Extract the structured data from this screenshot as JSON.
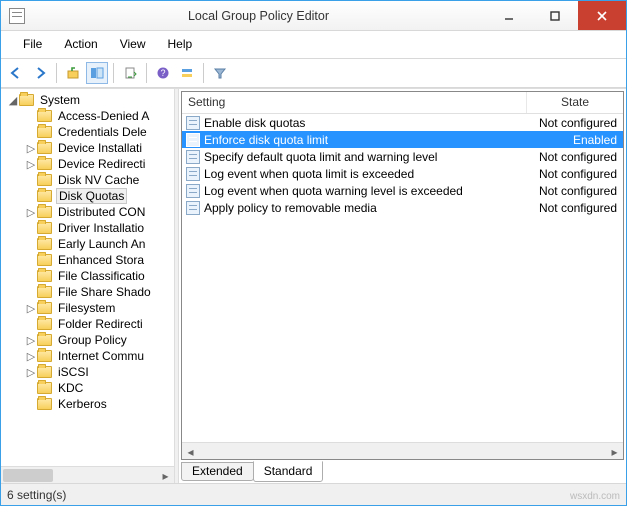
{
  "window": {
    "title": "Local Group Policy Editor"
  },
  "menu": {
    "items": [
      "File",
      "Action",
      "View",
      "Help"
    ]
  },
  "tree": {
    "root": {
      "label": "System",
      "expanded": true
    },
    "items": [
      {
        "label": "Access-Denied A",
        "expandable": false
      },
      {
        "label": "Credentials Dele",
        "expandable": false
      },
      {
        "label": "Device Installati",
        "expandable": true
      },
      {
        "label": "Device Redirecti",
        "expandable": true
      },
      {
        "label": "Disk NV Cache",
        "expandable": false
      },
      {
        "label": "Disk Quotas",
        "expandable": false,
        "selected": true
      },
      {
        "label": "Distributed CON",
        "expandable": true
      },
      {
        "label": "Driver Installatio",
        "expandable": false
      },
      {
        "label": "Early Launch An",
        "expandable": false
      },
      {
        "label": "Enhanced Stora",
        "expandable": false
      },
      {
        "label": "File Classificatio",
        "expandable": false
      },
      {
        "label": "File Share Shado",
        "expandable": false
      },
      {
        "label": "Filesystem",
        "expandable": true
      },
      {
        "label": "Folder Redirecti",
        "expandable": false
      },
      {
        "label": "Group Policy",
        "expandable": true
      },
      {
        "label": "Internet Commu",
        "expandable": true
      },
      {
        "label": "iSCSI",
        "expandable": true
      },
      {
        "label": "KDC",
        "expandable": false
      },
      {
        "label": "Kerberos",
        "expandable": false
      }
    ]
  },
  "list": {
    "columns": {
      "setting": "Setting",
      "state": "State"
    },
    "rows": [
      {
        "setting": "Enable disk quotas",
        "state": "Not configured",
        "selected": false
      },
      {
        "setting": "Enforce disk quota limit",
        "state": "Enabled",
        "selected": true
      },
      {
        "setting": "Specify default quota limit and warning level",
        "state": "Not configured",
        "selected": false
      },
      {
        "setting": "Log event when quota limit is exceeded",
        "state": "Not configured",
        "selected": false
      },
      {
        "setting": "Log event when quota warning level is exceeded",
        "state": "Not configured",
        "selected": false
      },
      {
        "setting": "Apply policy to removable media",
        "state": "Not configured",
        "selected": false
      }
    ]
  },
  "tabs": {
    "items": [
      "Extended",
      "Standard"
    ],
    "active": 1
  },
  "status": {
    "text": "6 setting(s)"
  },
  "watermark": "wsxdn.com"
}
